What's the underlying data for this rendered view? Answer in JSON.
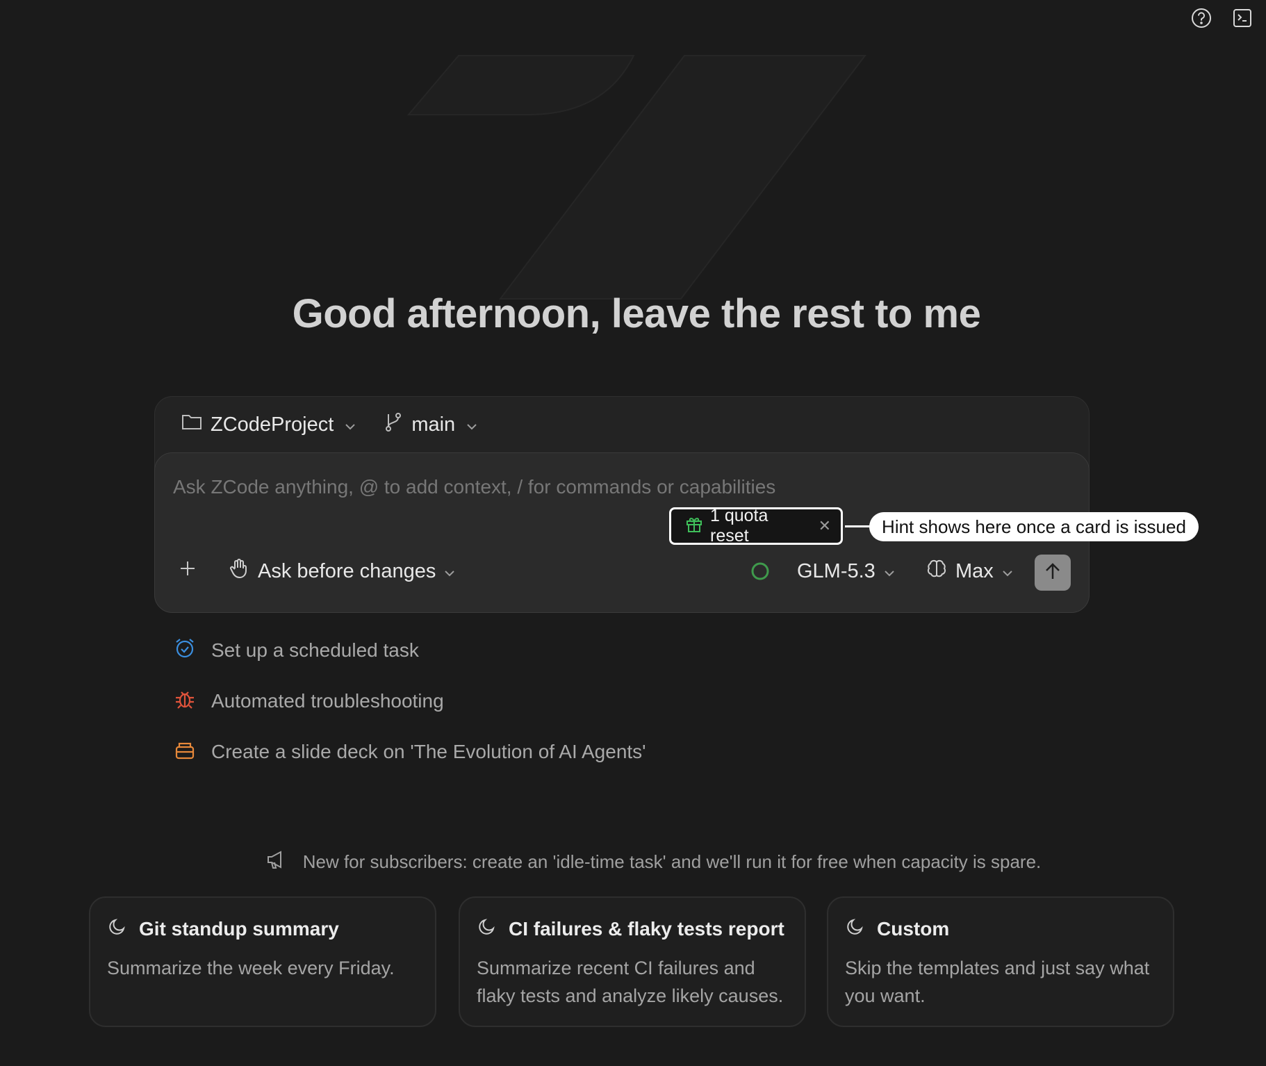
{
  "topbar": {
    "help_icon": "help-circle-icon",
    "terminal_icon": "terminal-icon"
  },
  "greeting": "Good afternoon, leave the rest to me",
  "composer": {
    "project": "ZCodeProject",
    "branch": "main",
    "input_placeholder": "Ask ZCode anything, @ to add context, / for commands or capabilities",
    "input_value": "",
    "quota_chip": "1 quota reset",
    "hint": "Hint shows here once a card is issued",
    "mode": "Ask before changes",
    "model": "GLM-5.3",
    "effort": "Max"
  },
  "suggestions": [
    {
      "label": "Set up a scheduled task",
      "icon": "alarm-clock-icon",
      "color": "#3b8fe0"
    },
    {
      "label": "Automated troubleshooting",
      "icon": "bug-icon",
      "color": "#e0533b"
    },
    {
      "label": "Create a slide deck on 'The Evolution of AI Agents'",
      "icon": "slides-icon",
      "color": "#e8893a"
    }
  ],
  "announcement": "New for subscribers: create an 'idle-time task' and we'll run it for free when capacity is spare.",
  "cards": [
    {
      "title": "Git standup summary",
      "desc": "Summarize the week every Friday."
    },
    {
      "title": "CI failures & flaky tests report",
      "desc": "Summarize recent CI failures and flaky tests and analyze likely causes."
    },
    {
      "title": "Custom",
      "desc": "Skip the templates and just say what you want."
    }
  ],
  "colors": {
    "background": "#1b1b1b",
    "composer": "#2b2b2b",
    "accent_green": "#3f9a4c"
  }
}
